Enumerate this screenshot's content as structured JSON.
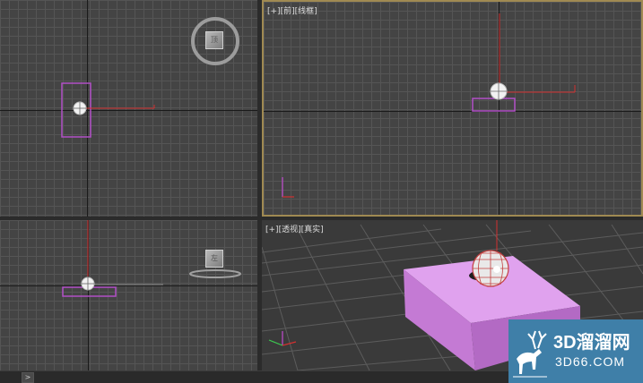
{
  "viewports": {
    "front": {
      "label_plus": "[+]",
      "label_view": "[前]",
      "label_mode": "[线框]"
    },
    "perspective": {
      "label_plus": "[+]",
      "label_view": "[透视]",
      "label_mode": "[真实]"
    }
  },
  "view_cube": {
    "top_face": "顶",
    "left_face": "左"
  },
  "status_bar": {
    "expand_arrow": ">"
  },
  "watermark": {
    "title": "3D溜溜网",
    "url": "3D66.COM",
    "logo": "deer-logo"
  },
  "colors": {
    "grid_bg": "#444444",
    "active_border": "#a08a52",
    "selection_box": "#b24fc7",
    "gizmo_red": "#d23030",
    "box_fill": "#d686e4",
    "watermark_bg": "#3f7fa8"
  }
}
